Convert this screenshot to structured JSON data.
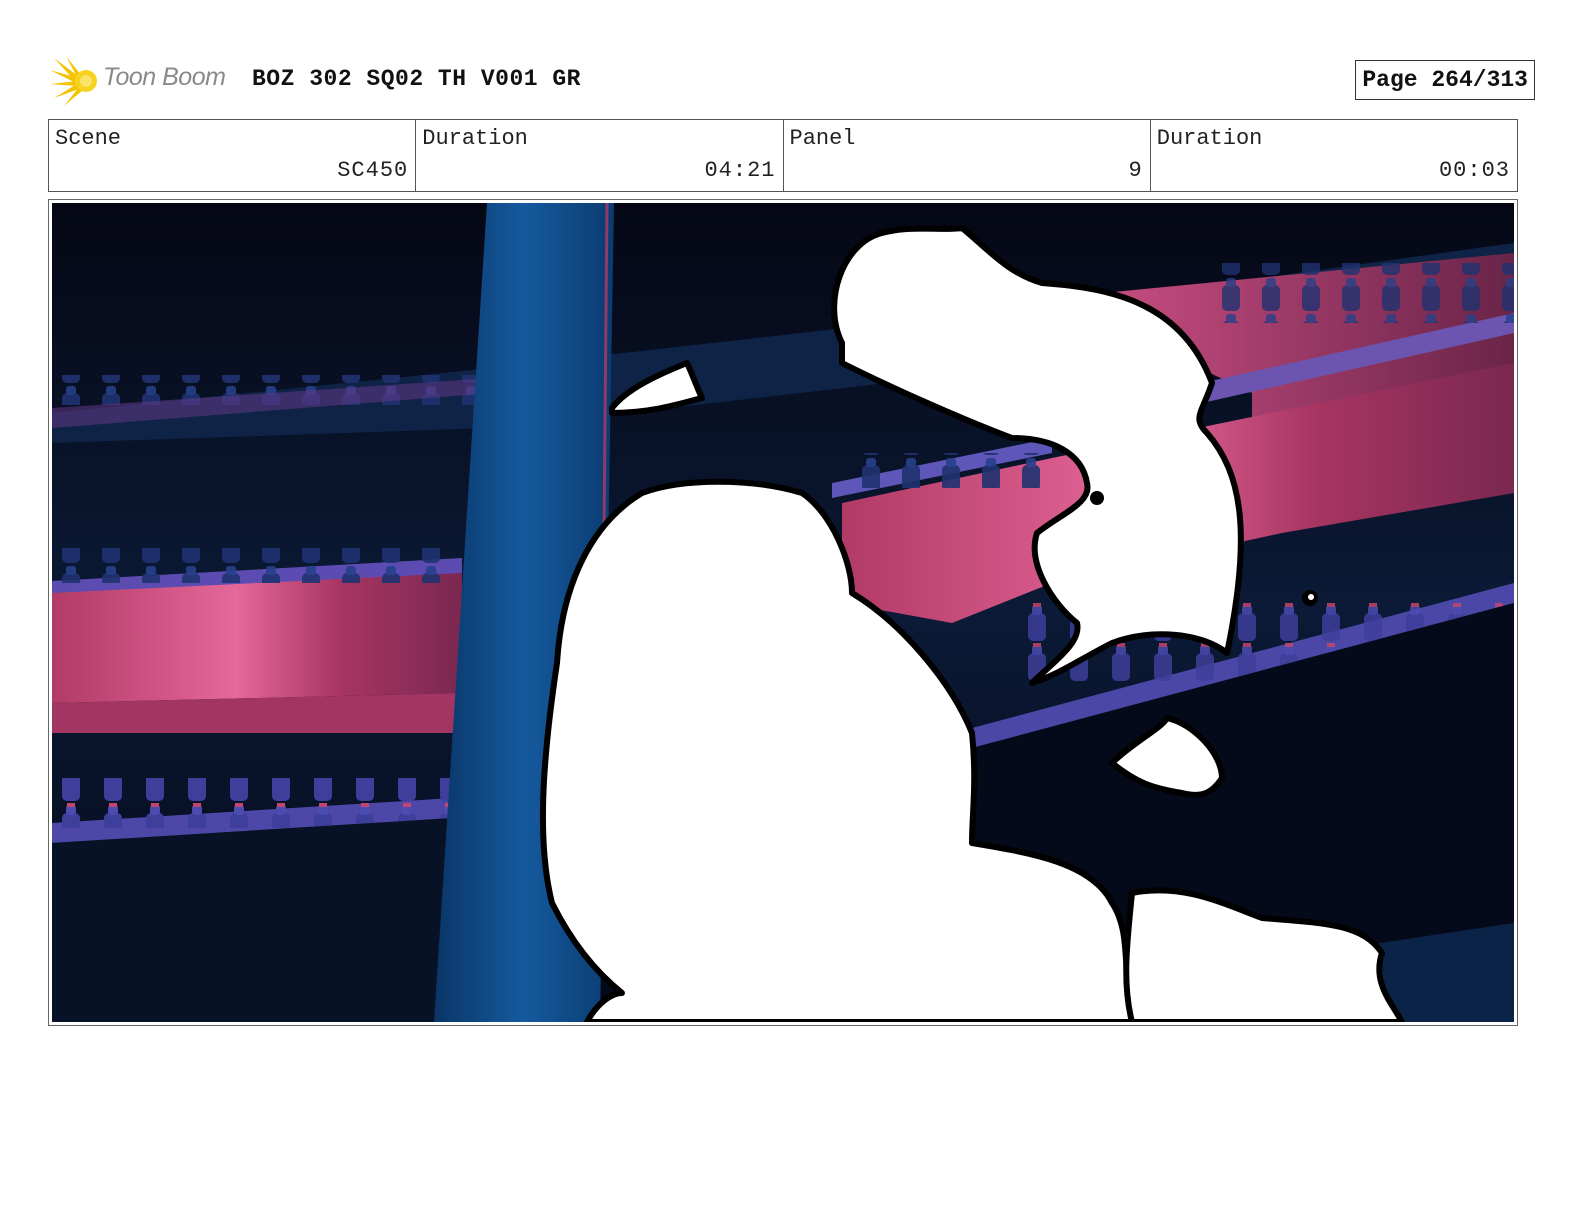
{
  "header": {
    "logo_text": "Toon Boom",
    "title": "BOZ 302 SQ02 TH V001 GR",
    "page": "Page 264/313"
  },
  "info": {
    "scene_label": "Scene",
    "scene_value": "SC450",
    "scene_duration_label": "Duration",
    "scene_duration_value": "04:21",
    "panel_label": "Panel",
    "panel_value": "9",
    "panel_duration_label": "Duration",
    "panel_duration_value": "00:03"
  },
  "colors": {
    "logo_yellow": "#f5c400",
    "theater_pink": "#c23f72",
    "pillar_blue": "#0f4a85",
    "background_navy": "#06091a"
  }
}
